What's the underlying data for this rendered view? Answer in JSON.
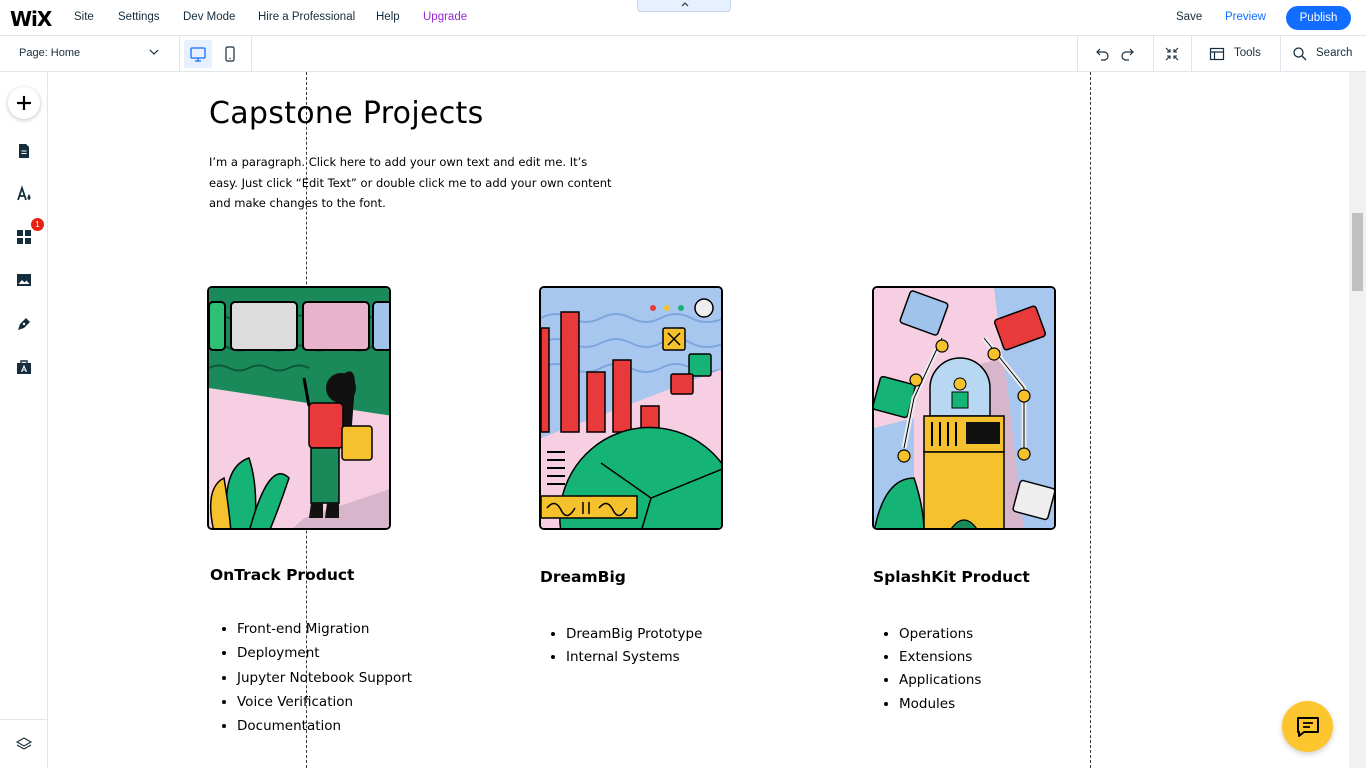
{
  "topbar": {
    "logo": "WiX",
    "menu": [
      "Site",
      "Settings",
      "Dev Mode",
      "Hire a Professional",
      "Help"
    ],
    "upgrade": "Upgrade",
    "collapse_icon": "^",
    "save": "Save",
    "preview": "Preview",
    "publish": "Publish"
  },
  "toolbar": {
    "page_label": "Page: Home",
    "tools": "Tools",
    "search": "Search"
  },
  "sidebar": {
    "badge": "1",
    "icons": [
      "add-icon",
      "pages-icon",
      "design-icon",
      "apps-icon",
      "media-icon",
      "blog-icon",
      "business-icon",
      "layers-icon"
    ]
  },
  "page": {
    "heading": "Capstone Projects",
    "paragraph": "I’m a paragraph. Click here to add your own text and edit me. It’s easy. Just click “Edit Text” or double click me to add your own content and make changes to the font.",
    "cards": [
      {
        "title": "OnTrack Product",
        "items": [
          "Front-end Migration",
          "Deployment",
          "Jupyter Notebook Support",
          "Voice Verification",
          "Documentation"
        ]
      },
      {
        "title": "DreamBig",
        "items": [
          "DreamBig Prototype",
          "Internal Systems"
        ]
      },
      {
        "title": "SplashKit Product",
        "items": [
          "Operations",
          "Extensions",
          "Applications",
          "Modules"
        ]
      }
    ]
  },
  "colors": {
    "accent": "#116dff",
    "upgrade": "#9a27d5",
    "chat": "#fdc62f",
    "badge": "#e62214"
  }
}
